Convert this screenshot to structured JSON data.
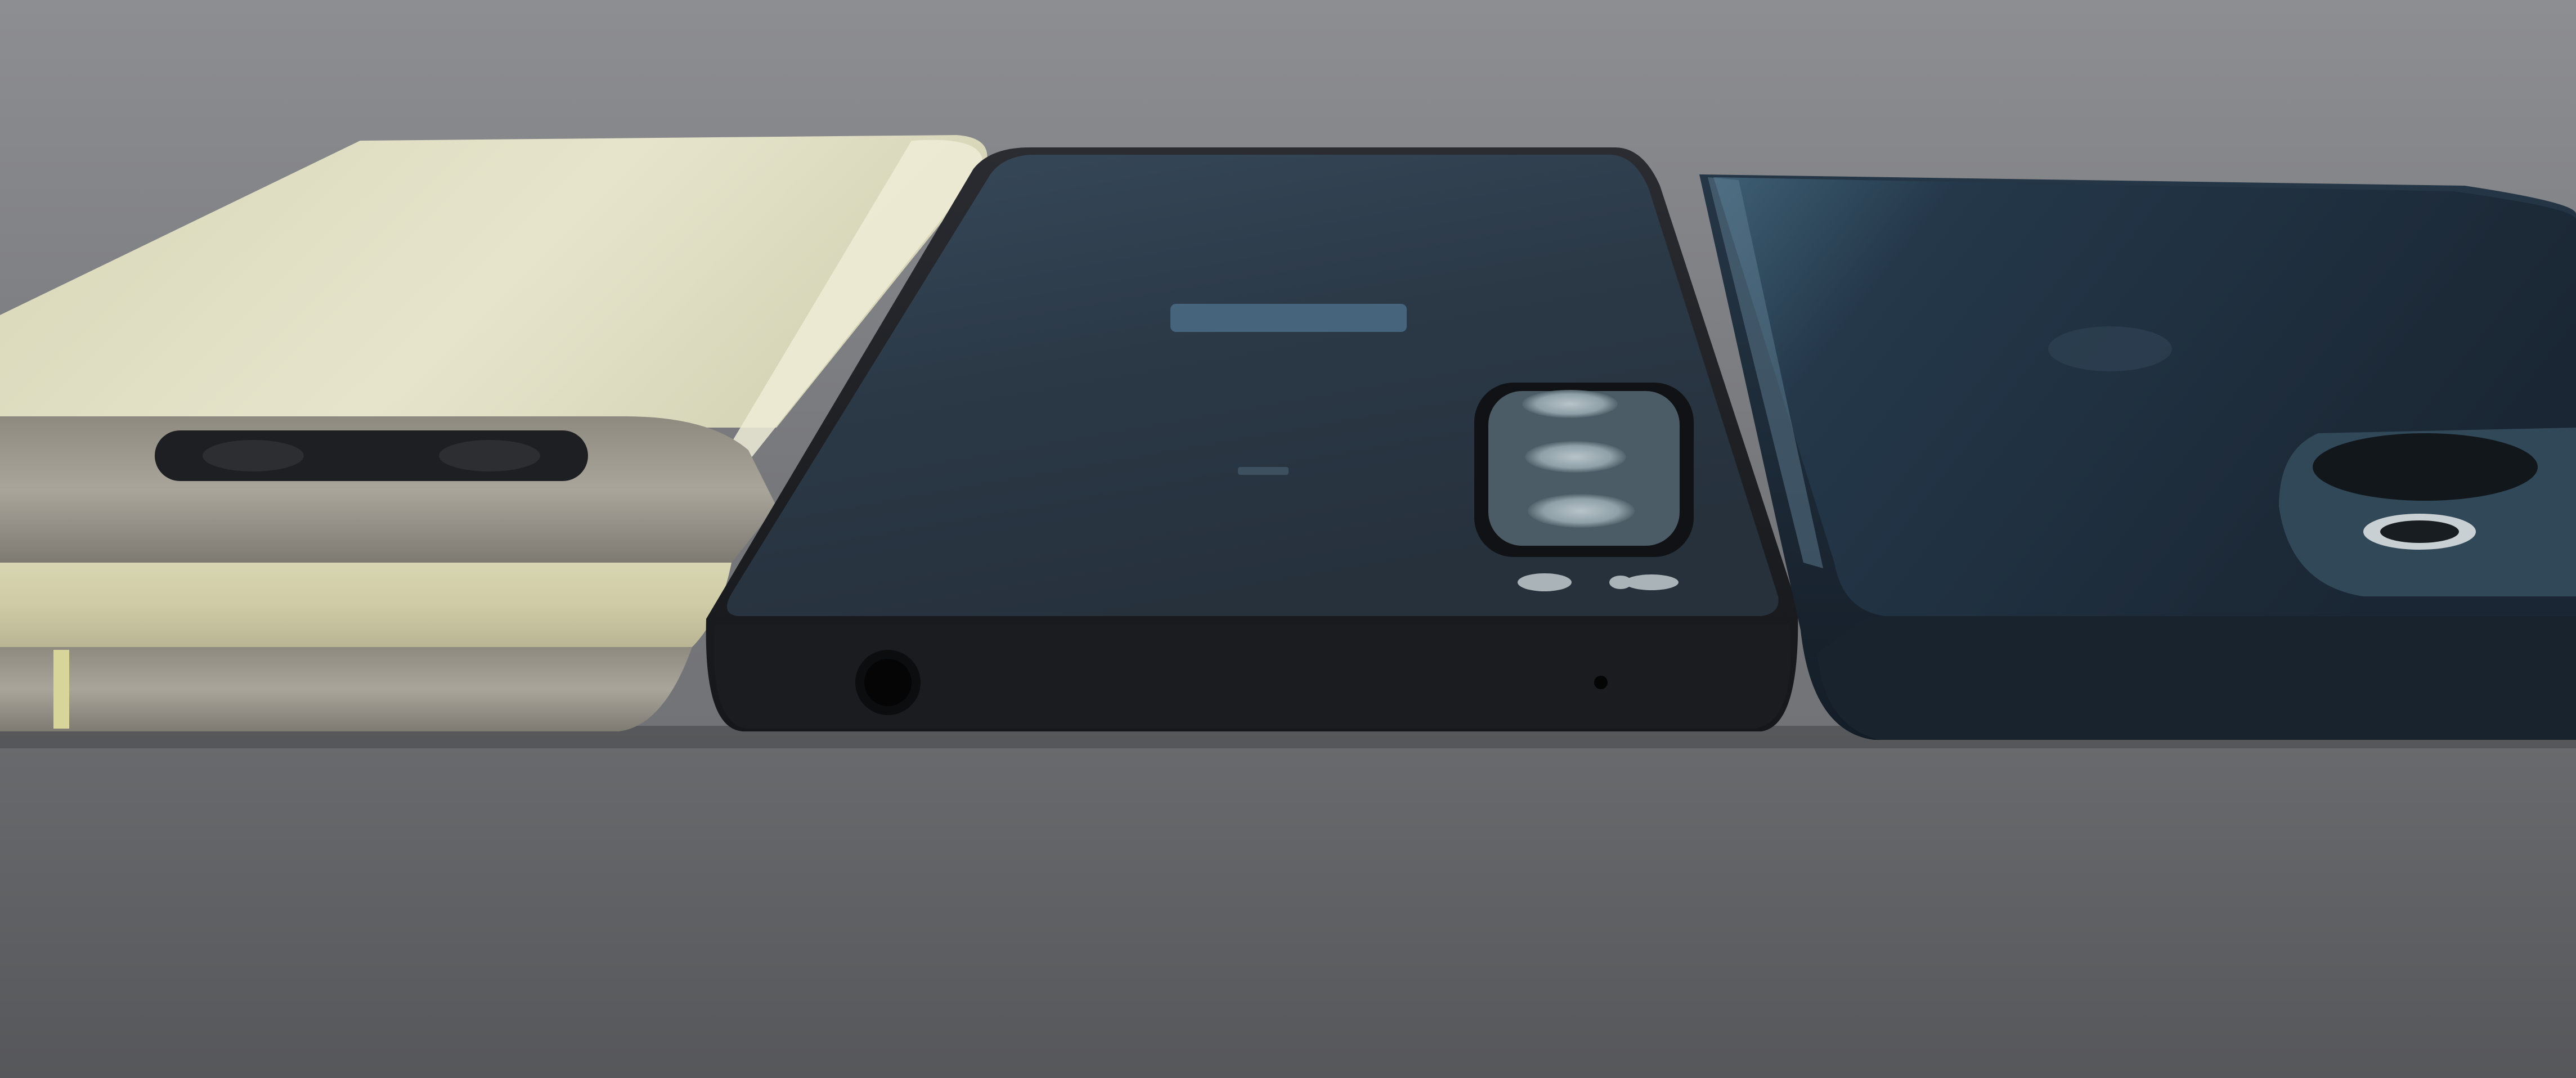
{
  "scene": {
    "colors": {
      "background_top": "#8d8e92",
      "background_mid": "#737478",
      "table_near": "#5a5b5e",
      "table_far": "#6a6b6e",
      "pixel_cream": "#e2e0c4",
      "pixel_cream_shade": "#c8c5a4",
      "pixel_metal": "#9a968d",
      "xperia_black": "#1d1f23",
      "xperia_glass": "#2e3f4d",
      "iphone_navy": "#1b2836"
    },
    "phones": [
      {
        "name": "cream-phone-left"
      },
      {
        "name": "black-phone-center"
      },
      {
        "name": "navy-phone-right"
      }
    ]
  }
}
